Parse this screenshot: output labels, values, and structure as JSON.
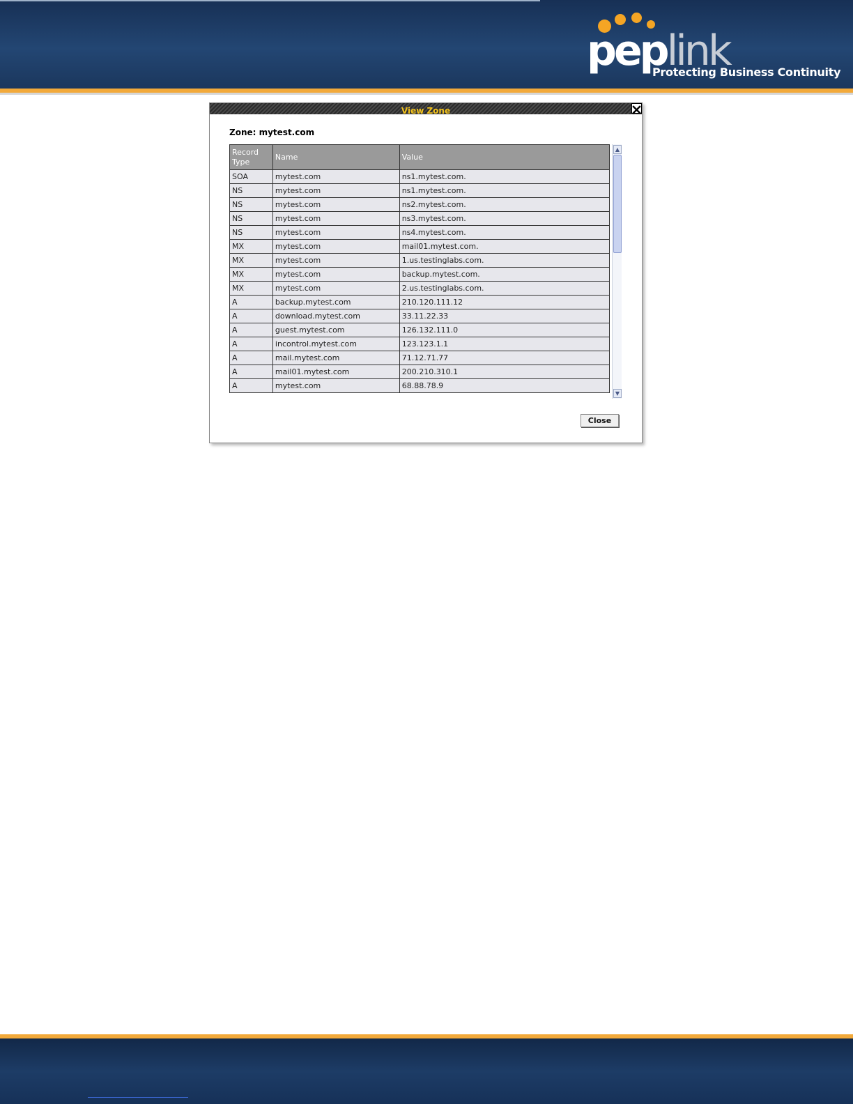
{
  "branding": {
    "logo_text_white": "pep",
    "logo_text_gray": "link",
    "tagline": "Protecting Business Continuity",
    "accent_color": "#f2a93a",
    "logo_dot_color": "#f5a524"
  },
  "dialog": {
    "title": "View Zone",
    "close_icon": "close-icon",
    "zone_label": "Zone: mytest.com",
    "columns": [
      "Record\nType",
      "Name",
      "Value"
    ],
    "rows": [
      [
        "SOA",
        "mytest.com",
        "ns1.mytest.com."
      ],
      [
        "NS",
        "mytest.com",
        "ns1.mytest.com."
      ],
      [
        "NS",
        "mytest.com",
        "ns2.mytest.com."
      ],
      [
        "NS",
        "mytest.com",
        "ns3.mytest.com."
      ],
      [
        "NS",
        "mytest.com",
        "ns4.mytest.com."
      ],
      [
        "MX",
        "mytest.com",
        "mail01.mytest.com."
      ],
      [
        "MX",
        "mytest.com",
        "1.us.testinglabs.com."
      ],
      [
        "MX",
        "mytest.com",
        "backup.mytest.com."
      ],
      [
        "MX",
        "mytest.com",
        "2.us.testinglabs.com."
      ],
      [
        "A",
        "backup.mytest.com",
        "210.120.111.12"
      ],
      [
        "A",
        "download.mytest.com",
        "33.11.22.33"
      ],
      [
        "A",
        "guest.mytest.com",
        "126.132.111.0"
      ],
      [
        "A",
        "incontrol.mytest.com",
        "123.123.1.1"
      ],
      [
        "A",
        "mail.mytest.com",
        "71.12.71.77"
      ],
      [
        "A",
        "mail01.mytest.com",
        "200.210.310.1"
      ],
      [
        "A",
        "mytest.com",
        "68.88.78.9"
      ]
    ],
    "close_button_label": "Close"
  }
}
